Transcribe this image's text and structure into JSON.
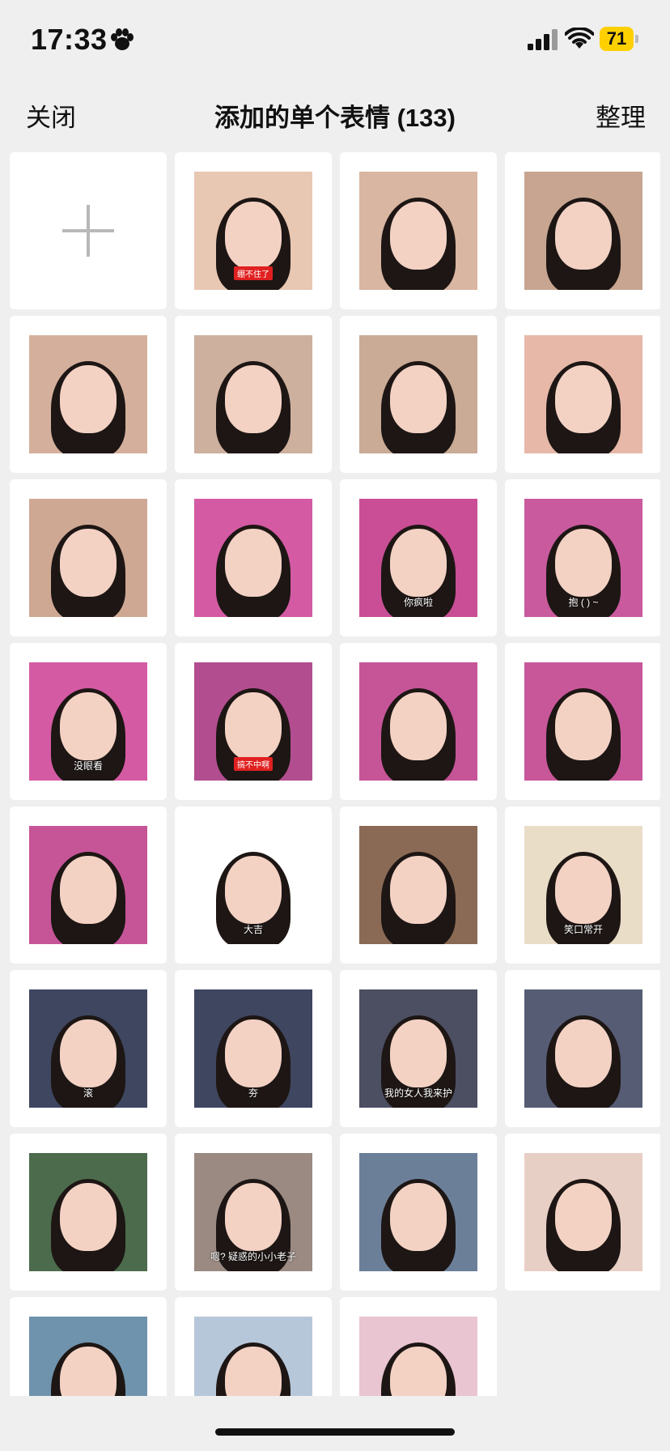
{
  "status_bar": {
    "time": "17:33",
    "battery": "71",
    "battery_color": "#ffd000"
  },
  "nav": {
    "close_label": "关闭",
    "title": "添加的单个表情 (133)",
    "organize_label": "整理"
  },
  "grid": {
    "add_icon": "plus-icon",
    "items": [
      {
        "bg": "#f4f4f4",
        "caption": "",
        "tag": ""
      },
      {
        "bg": "#e8c7b3",
        "caption": "",
        "tag": "绷不住了"
      },
      {
        "bg": "#d9b6a1",
        "caption": "",
        "tag": ""
      },
      {
        "bg": "#c7a590",
        "caption": "",
        "tag": ""
      },
      {
        "bg": "#d4b09c",
        "caption": "",
        "tag": ""
      },
      {
        "bg": "#ceb09e",
        "caption": "",
        "tag": ""
      },
      {
        "bg": "#c9ab96",
        "caption": "",
        "tag": ""
      },
      {
        "bg": "#e7b8a8",
        "caption": "",
        "tag": ""
      },
      {
        "bg": "#cfa894",
        "caption": "",
        "tag": ""
      },
      {
        "bg": "#d45aa3",
        "caption": "",
        "tag": ""
      },
      {
        "bg": "#c94e95",
        "caption": "你疯啦",
        "tag": ""
      },
      {
        "bg": "#c95a9d",
        "caption": "抱 (     ) ~",
        "tag": ""
      },
      {
        "bg": "#d45aa3",
        "caption": "没眼看",
        "tag": ""
      },
      {
        "bg": "#b24e8f",
        "caption": "",
        "tag": "搞不中啊"
      },
      {
        "bg": "#c65598",
        "caption": "",
        "tag": ""
      },
      {
        "bg": "#c8579a",
        "caption": "",
        "tag": ""
      },
      {
        "bg": "#c65598",
        "caption": "",
        "tag": ""
      },
      {
        "bg": "#ffffff",
        "caption": "大吉",
        "tag": ""
      },
      {
        "bg": "#8a6a55",
        "caption": "",
        "tag": ""
      },
      {
        "bg": "#e9ddc8",
        "caption": "笑口常开",
        "tag": ""
      },
      {
        "bg": "#3e4660",
        "caption": "滚",
        "tag": ""
      },
      {
        "bg": "#3e4660",
        "caption": "夯",
        "tag": ""
      },
      {
        "bg": "#4c4e62",
        "caption": "我的女人我来护",
        "tag": ""
      },
      {
        "bg": "#565c74",
        "caption": "",
        "tag": ""
      },
      {
        "bg": "#4c6b4c",
        "caption": "",
        "tag": ""
      },
      {
        "bg": "#9a8a82",
        "caption": "嗯? 疑惑的小小老子",
        "tag": ""
      },
      {
        "bg": "#6b7f99",
        "caption": "",
        "tag": ""
      },
      {
        "bg": "#e8cfc6",
        "caption": "",
        "tag": ""
      },
      {
        "bg": "#6f93ad",
        "caption": "",
        "tag": ""
      },
      {
        "bg": "#b7c7da",
        "caption": "",
        "tag": ""
      },
      {
        "bg": "#e9c5d1",
        "caption": "",
        "tag": ""
      }
    ]
  }
}
